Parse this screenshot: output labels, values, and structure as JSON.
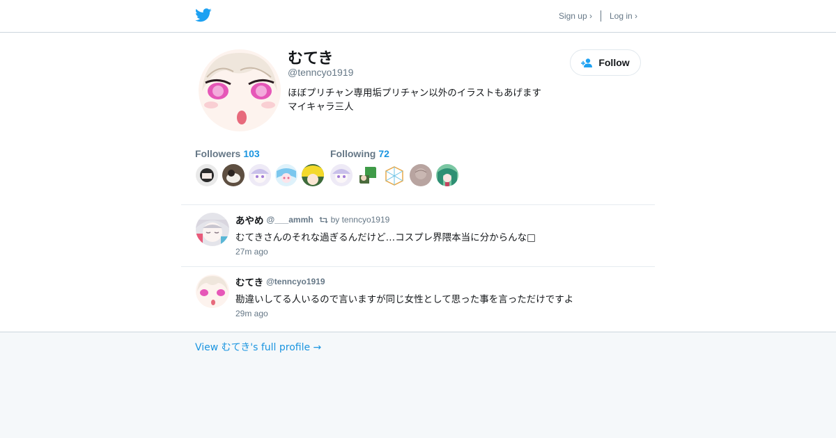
{
  "header": {
    "signup": "Sign up ›",
    "login": "Log in ›"
  },
  "profile": {
    "name": "むてき",
    "handle": "@tenncyo1919",
    "bio_line1": "ほぼプリチャン専用垢プリチャン以外のイラストもあげます",
    "bio_line2": "マイキャラ三人",
    "follow_label": "Follow",
    "followers_label": "Followers",
    "followers_count": "103",
    "following_label": "Following",
    "following_count": "72"
  },
  "tweets": [
    {
      "name": "あやめ",
      "handle": "@___ammh",
      "retweet": "by tenncyo1919",
      "text": "むてきさんのそれな過ぎるんだけど…コスプレ界隈本当に分からんな□",
      "time": "27m ago"
    },
    {
      "name": "むてき",
      "handle": "@tenncyo1919",
      "text": "勘違いしてる人いるので言いますが同じ女性として思った事を言っただけですよ",
      "time": "29m ago"
    }
  ],
  "footer": {
    "view_profile": "View むてき's full profile →"
  },
  "colors": {
    "accent": "#1b95e0",
    "twitter_blue": "#1da1f2",
    "muted": "#657786"
  },
  "icons": [
    "twitter-bird-icon",
    "add-user-icon",
    "retweet-icon"
  ]
}
